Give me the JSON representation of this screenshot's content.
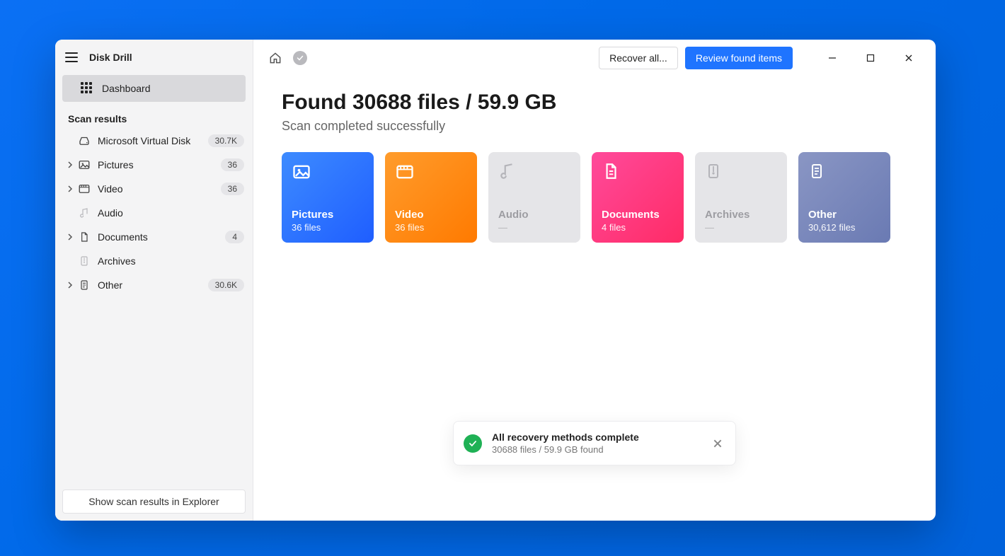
{
  "app": {
    "title": "Disk Drill"
  },
  "sidebar": {
    "dashboard": "Dashboard",
    "section": "Scan results",
    "items": [
      {
        "label": "Microsoft Virtual Disk",
        "badge": "30.7K",
        "icon": "disk-icon",
        "chevron": false
      },
      {
        "label": "Pictures",
        "badge": "36",
        "icon": "image-icon",
        "chevron": true
      },
      {
        "label": "Video",
        "badge": "36",
        "icon": "video-icon",
        "chevron": true
      },
      {
        "label": "Audio",
        "badge": "",
        "icon": "music-icon",
        "chevron": false
      },
      {
        "label": "Documents",
        "badge": "4",
        "icon": "document-icon",
        "chevron": true
      },
      {
        "label": "Archives",
        "badge": "",
        "icon": "archive-icon",
        "chevron": false
      },
      {
        "label": "Other",
        "badge": "30.6K",
        "icon": "other-icon",
        "chevron": true
      }
    ],
    "footer": "Show scan results in Explorer"
  },
  "topbar": {
    "recover": "Recover all...",
    "review": "Review found items"
  },
  "summary": {
    "headline": "Found 30688 files / 59.9 GB",
    "subhead": "Scan completed successfully"
  },
  "cards": {
    "pictures": {
      "name": "Pictures",
      "count": "36 files"
    },
    "video": {
      "name": "Video",
      "count": "36 files"
    },
    "audio": {
      "name": "Audio",
      "count": "—"
    },
    "documents": {
      "name": "Documents",
      "count": "4 files"
    },
    "archives": {
      "name": "Archives",
      "count": "—"
    },
    "other": {
      "name": "Other",
      "count": "30,612 files"
    }
  },
  "toast": {
    "title": "All recovery methods complete",
    "sub": "30688 files / 59.9 GB found"
  }
}
